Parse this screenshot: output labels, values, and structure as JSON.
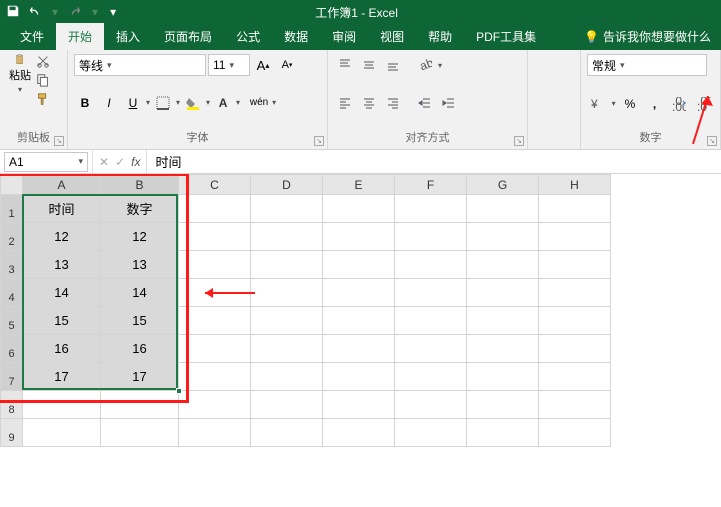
{
  "window": {
    "title": "工作簿1 - Excel"
  },
  "tabs": {
    "file": "文件",
    "home": "开始",
    "insert": "插入",
    "layout": "页面布局",
    "formulas": "公式",
    "data": "数据",
    "review": "审阅",
    "view": "视图",
    "help": "帮助",
    "pdf": "PDF工具集",
    "tell": "告诉我你想要做什么"
  },
  "ribbon": {
    "clipboard": {
      "label": "剪贴板",
      "paste": "粘贴"
    },
    "font": {
      "label": "字体",
      "name": "等线",
      "size": "11",
      "bold": "B",
      "italic": "I",
      "underline": "U",
      "wen": "wén"
    },
    "align": {
      "label": "对齐方式"
    },
    "number": {
      "label": "数字",
      "format": "常规",
      "percent": "%",
      "comma": ","
    }
  },
  "formulaBar": {
    "nameBox": "A1",
    "value": "时间",
    "fx": "fx"
  },
  "columns": [
    "A",
    "B",
    "C",
    "D",
    "E",
    "F",
    "G",
    "H"
  ],
  "rows": [
    "1",
    "2",
    "3",
    "4",
    "5",
    "6",
    "7",
    "8",
    "9"
  ],
  "cells": {
    "headers": [
      "时间",
      "数字"
    ],
    "data": [
      [
        "12",
        "12"
      ],
      [
        "13",
        "13"
      ],
      [
        "14",
        "14"
      ],
      [
        "15",
        "15"
      ],
      [
        "16",
        "16"
      ],
      [
        "17",
        "17"
      ]
    ]
  },
  "colWidths": {
    "row": 22,
    "A": 78,
    "B": 78,
    "other": 72
  }
}
